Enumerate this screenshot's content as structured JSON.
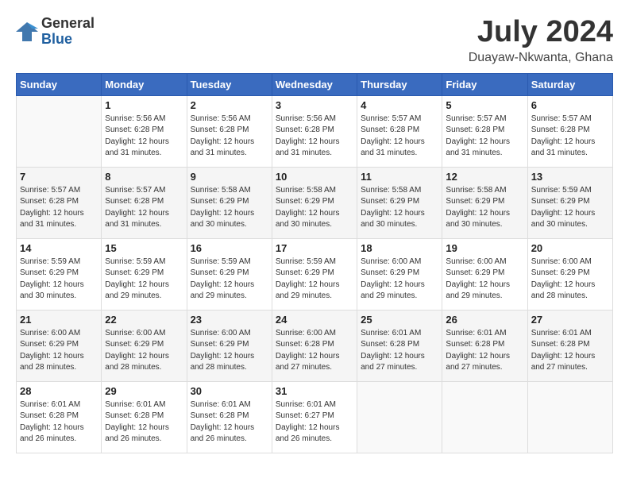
{
  "logo": {
    "general": "General",
    "blue": "Blue"
  },
  "title": {
    "month_year": "July 2024",
    "location": "Duayaw-Nkwanta, Ghana"
  },
  "days_of_week": [
    "Sunday",
    "Monday",
    "Tuesday",
    "Wednesday",
    "Thursday",
    "Friday",
    "Saturday"
  ],
  "weeks": [
    [
      {
        "num": "",
        "info": ""
      },
      {
        "num": "1",
        "info": "Sunrise: 5:56 AM\nSunset: 6:28 PM\nDaylight: 12 hours\nand 31 minutes."
      },
      {
        "num": "2",
        "info": "Sunrise: 5:56 AM\nSunset: 6:28 PM\nDaylight: 12 hours\nand 31 minutes."
      },
      {
        "num": "3",
        "info": "Sunrise: 5:56 AM\nSunset: 6:28 PM\nDaylight: 12 hours\nand 31 minutes."
      },
      {
        "num": "4",
        "info": "Sunrise: 5:57 AM\nSunset: 6:28 PM\nDaylight: 12 hours\nand 31 minutes."
      },
      {
        "num": "5",
        "info": "Sunrise: 5:57 AM\nSunset: 6:28 PM\nDaylight: 12 hours\nand 31 minutes."
      },
      {
        "num": "6",
        "info": "Sunrise: 5:57 AM\nSunset: 6:28 PM\nDaylight: 12 hours\nand 31 minutes."
      }
    ],
    [
      {
        "num": "7",
        "info": "Sunrise: 5:57 AM\nSunset: 6:28 PM\nDaylight: 12 hours\nand 31 minutes."
      },
      {
        "num": "8",
        "info": "Sunrise: 5:57 AM\nSunset: 6:28 PM\nDaylight: 12 hours\nand 31 minutes."
      },
      {
        "num": "9",
        "info": "Sunrise: 5:58 AM\nSunset: 6:29 PM\nDaylight: 12 hours\nand 30 minutes."
      },
      {
        "num": "10",
        "info": "Sunrise: 5:58 AM\nSunset: 6:29 PM\nDaylight: 12 hours\nand 30 minutes."
      },
      {
        "num": "11",
        "info": "Sunrise: 5:58 AM\nSunset: 6:29 PM\nDaylight: 12 hours\nand 30 minutes."
      },
      {
        "num": "12",
        "info": "Sunrise: 5:58 AM\nSunset: 6:29 PM\nDaylight: 12 hours\nand 30 minutes."
      },
      {
        "num": "13",
        "info": "Sunrise: 5:59 AM\nSunset: 6:29 PM\nDaylight: 12 hours\nand 30 minutes."
      }
    ],
    [
      {
        "num": "14",
        "info": "Sunrise: 5:59 AM\nSunset: 6:29 PM\nDaylight: 12 hours\nand 30 minutes."
      },
      {
        "num": "15",
        "info": "Sunrise: 5:59 AM\nSunset: 6:29 PM\nDaylight: 12 hours\nand 29 minutes."
      },
      {
        "num": "16",
        "info": "Sunrise: 5:59 AM\nSunset: 6:29 PM\nDaylight: 12 hours\nand 29 minutes."
      },
      {
        "num": "17",
        "info": "Sunrise: 5:59 AM\nSunset: 6:29 PM\nDaylight: 12 hours\nand 29 minutes."
      },
      {
        "num": "18",
        "info": "Sunrise: 6:00 AM\nSunset: 6:29 PM\nDaylight: 12 hours\nand 29 minutes."
      },
      {
        "num": "19",
        "info": "Sunrise: 6:00 AM\nSunset: 6:29 PM\nDaylight: 12 hours\nand 29 minutes."
      },
      {
        "num": "20",
        "info": "Sunrise: 6:00 AM\nSunset: 6:29 PM\nDaylight: 12 hours\nand 28 minutes."
      }
    ],
    [
      {
        "num": "21",
        "info": "Sunrise: 6:00 AM\nSunset: 6:29 PM\nDaylight: 12 hours\nand 28 minutes."
      },
      {
        "num": "22",
        "info": "Sunrise: 6:00 AM\nSunset: 6:29 PM\nDaylight: 12 hours\nand 28 minutes."
      },
      {
        "num": "23",
        "info": "Sunrise: 6:00 AM\nSunset: 6:29 PM\nDaylight: 12 hours\nand 28 minutes."
      },
      {
        "num": "24",
        "info": "Sunrise: 6:00 AM\nSunset: 6:28 PM\nDaylight: 12 hours\nand 27 minutes."
      },
      {
        "num": "25",
        "info": "Sunrise: 6:01 AM\nSunset: 6:28 PM\nDaylight: 12 hours\nand 27 minutes."
      },
      {
        "num": "26",
        "info": "Sunrise: 6:01 AM\nSunset: 6:28 PM\nDaylight: 12 hours\nand 27 minutes."
      },
      {
        "num": "27",
        "info": "Sunrise: 6:01 AM\nSunset: 6:28 PM\nDaylight: 12 hours\nand 27 minutes."
      }
    ],
    [
      {
        "num": "28",
        "info": "Sunrise: 6:01 AM\nSunset: 6:28 PM\nDaylight: 12 hours\nand 26 minutes."
      },
      {
        "num": "29",
        "info": "Sunrise: 6:01 AM\nSunset: 6:28 PM\nDaylight: 12 hours\nand 26 minutes."
      },
      {
        "num": "30",
        "info": "Sunrise: 6:01 AM\nSunset: 6:28 PM\nDaylight: 12 hours\nand 26 minutes."
      },
      {
        "num": "31",
        "info": "Sunrise: 6:01 AM\nSunset: 6:27 PM\nDaylight: 12 hours\nand 26 minutes."
      },
      {
        "num": "",
        "info": ""
      },
      {
        "num": "",
        "info": ""
      },
      {
        "num": "",
        "info": ""
      }
    ]
  ]
}
